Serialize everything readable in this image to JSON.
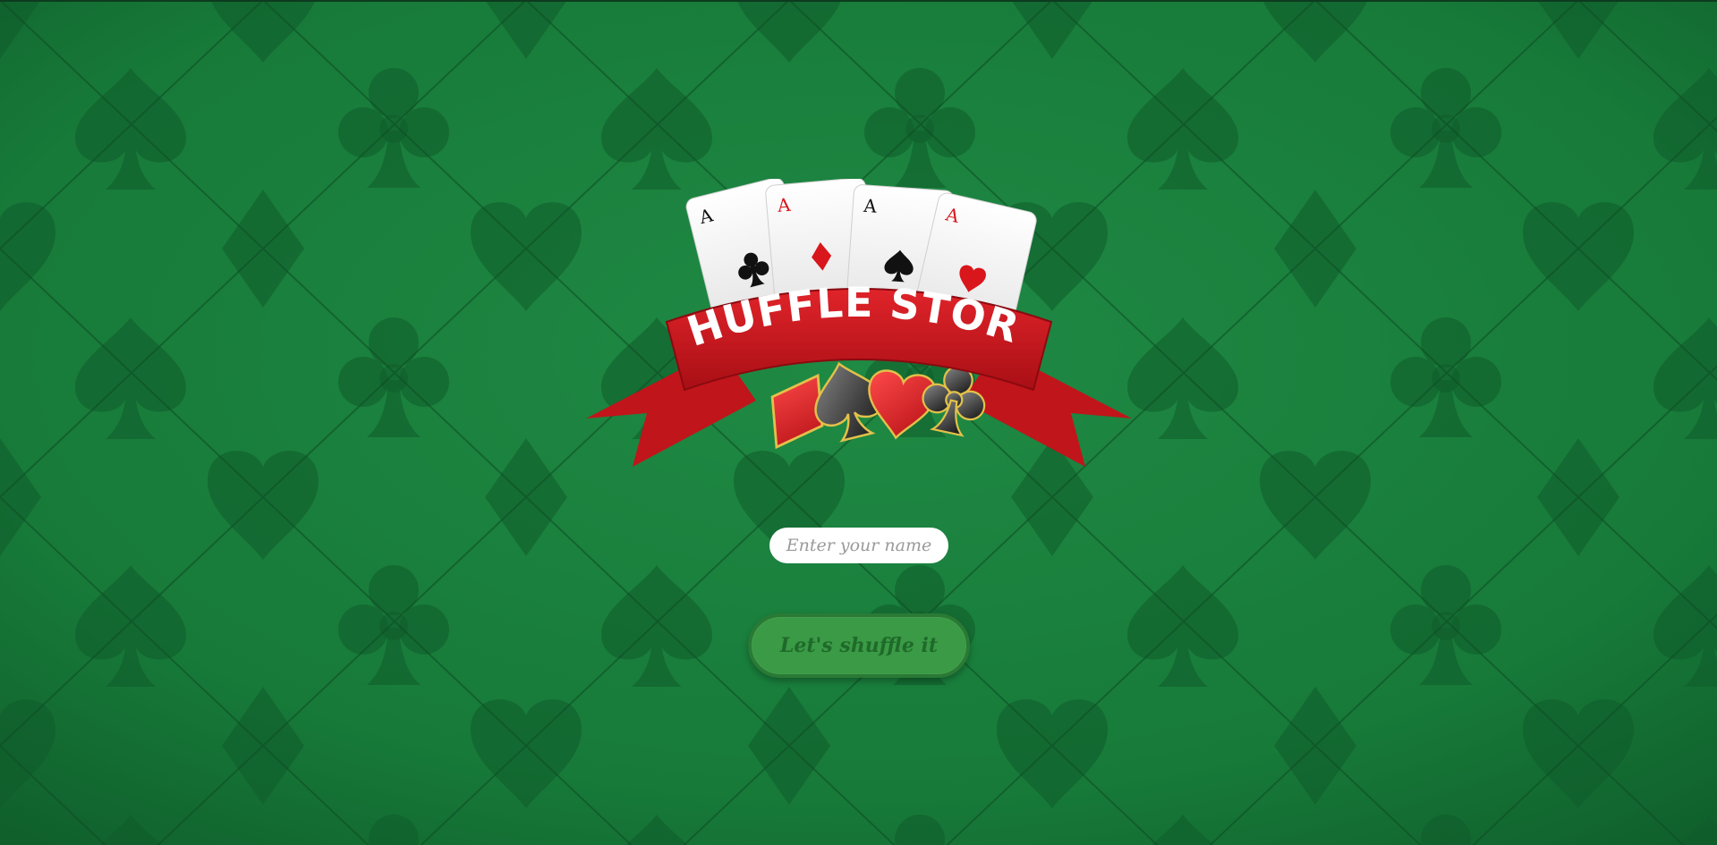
{
  "background": {
    "felt_color": "#1a7a3c",
    "pattern_icons": [
      "spade-icon",
      "club-icon",
      "heart-icon",
      "diamond-icon"
    ]
  },
  "logo": {
    "title": "SHUFFLE STORM",
    "cards": [
      {
        "rank": "A",
        "suit": "club-icon",
        "color": "#111111"
      },
      {
        "rank": "A",
        "suit": "diamond-icon",
        "color": "#d8161b"
      },
      {
        "rank": "A",
        "suit": "spade-icon",
        "color": "#111111"
      },
      {
        "rank": "A",
        "suit": "heart-icon",
        "color": "#d8161b"
      }
    ],
    "ribbon_color": "#c8141b",
    "emblems": [
      "diamond-icon",
      "spade-icon",
      "heart-icon",
      "club-icon"
    ]
  },
  "form": {
    "name_placeholder": "Enter your name",
    "name_value": "",
    "submit_label": "Let's shuffle it"
  }
}
